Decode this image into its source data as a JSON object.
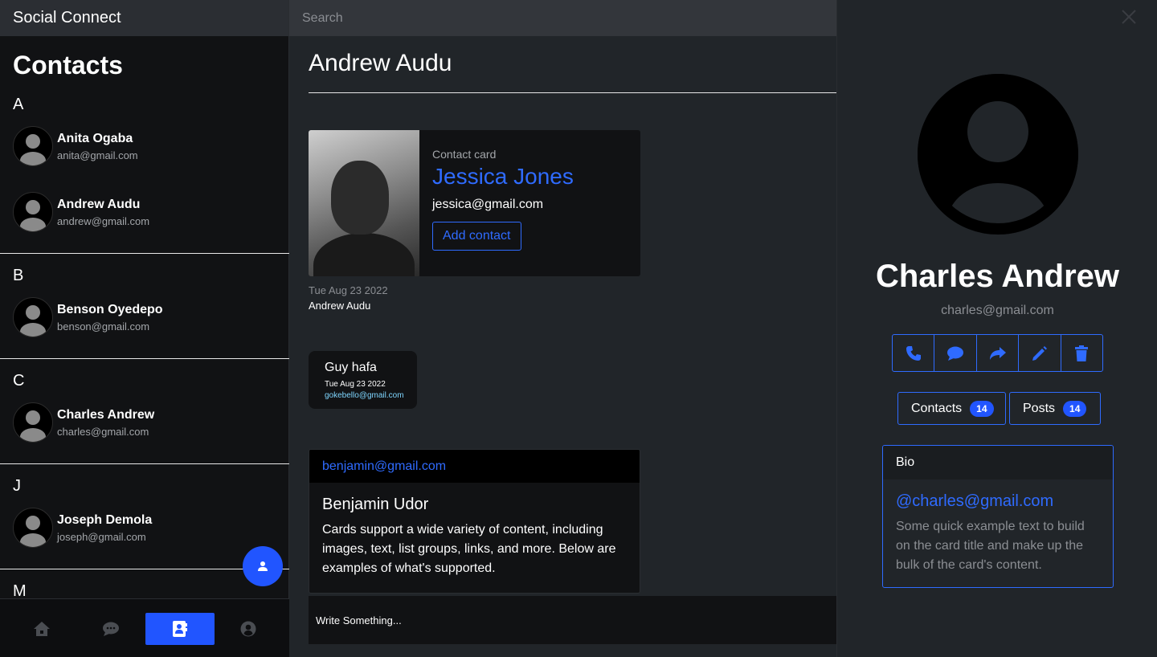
{
  "app": {
    "title": "Social Connect"
  },
  "sidebar": {
    "heading": "Contacts",
    "groups": [
      {
        "letter": "A",
        "contacts": [
          {
            "name": "Anita Ogaba",
            "email": "anita@gmail.com"
          },
          {
            "name": "Andrew Audu",
            "email": "andrew@gmail.com"
          }
        ]
      },
      {
        "letter": "B",
        "contacts": [
          {
            "name": "Benson Oyedepo",
            "email": "benson@gmail.com"
          }
        ]
      },
      {
        "letter": "C",
        "contacts": [
          {
            "name": "Charles Andrew",
            "email": "charles@gmail.com"
          }
        ]
      },
      {
        "letter": "J",
        "contacts": [
          {
            "name": "Joseph Demola",
            "email": "joseph@gmail.com"
          }
        ]
      },
      {
        "letter": "M",
        "contacts": []
      }
    ]
  },
  "nav": {
    "items": [
      {
        "icon": "home-icon",
        "active": false
      },
      {
        "icon": "chat-icon",
        "active": false
      },
      {
        "icon": "contacts-book-icon",
        "active": true
      },
      {
        "icon": "user-circle-icon",
        "active": false
      }
    ],
    "active_color": "#2155ff"
  },
  "search": {
    "placeholder": "Search"
  },
  "chat": {
    "title": "Andrew Audu",
    "contact_card": {
      "subtitle": "Contact card",
      "name": "Jessica Jones",
      "email": "jessica@gmail.com",
      "button_label": "Add contact",
      "date": "Tue Aug 23 2022",
      "author": "Andrew Audu"
    },
    "bubble": {
      "text": "Guy hafa",
      "date": "Tue Aug 23 2022",
      "email": "gokebello@gmail.com"
    },
    "post": {
      "header": "benjamin@gmail.com",
      "title": "Benjamin Udor",
      "text": "Cards support a wide variety of content, including images, text, list groups, links, and more. Below are examples of what's supported."
    },
    "compose_placeholder": "Write Something..."
  },
  "profile": {
    "name": "Charles Andrew",
    "email": "charles@gmail.com",
    "actions": [
      "phone-icon",
      "message-icon",
      "share-icon",
      "edit-icon",
      "trash-icon"
    ],
    "stats": {
      "contacts_label": "Contacts",
      "contacts_count": "14",
      "posts_label": "Posts",
      "posts_count": "14"
    },
    "bio": {
      "header": "Bio",
      "handle": "@charles@gmail.com",
      "text": "Some quick example text to build on the card title and make up the bulk of the card's content."
    }
  },
  "colors": {
    "accent": "#2f6bff",
    "primary": "#2155ff",
    "background": "#212529",
    "sidebar": "#111214"
  }
}
